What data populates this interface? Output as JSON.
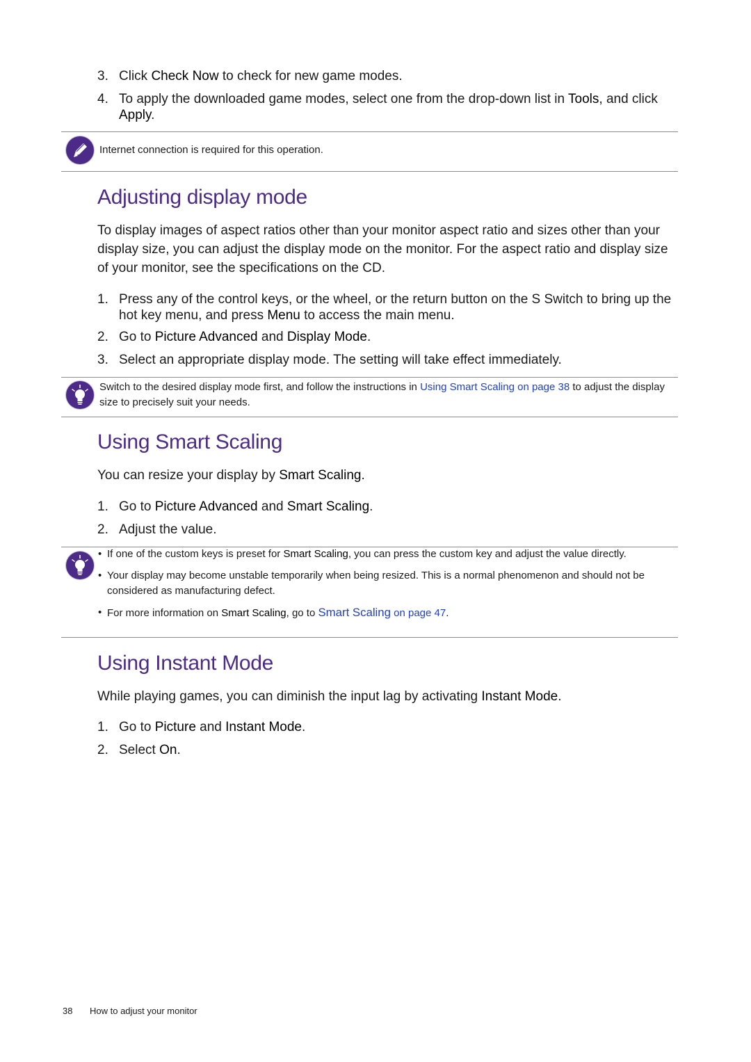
{
  "top_steps": [
    {
      "num": "3.",
      "parts": [
        {
          "t": "Click "
        },
        {
          "t": "Check Now",
          "b": true
        },
        {
          "t": " to check for new game modes."
        }
      ]
    },
    {
      "num": "4.",
      "parts": [
        {
          "t": "To apply the downloaded game modes, select one from the drop-down list in "
        },
        {
          "t": "Tools",
          "b": true
        },
        {
          "t": ", and click "
        },
        {
          "t": "Apply",
          "b": true
        },
        {
          "t": "."
        }
      ]
    }
  ],
  "note1": {
    "icon": "pencil-icon",
    "text": "Internet connection is required for this operation."
  },
  "section1": {
    "title": "Adjusting display mode",
    "intro": "To display images of aspect ratios other than your monitor aspect ratio and sizes other than your display size, you can adjust the display mode on the monitor. For the aspect ratio and display size of your monitor, see the specifications on the CD.",
    "steps": [
      {
        "num": "1.",
        "parts": [
          {
            "t": "Press any of the control keys, or the wheel, or the return button on the S Switch to bring up the hot key menu, and press "
          },
          {
            "t": "Menu",
            "b": true
          },
          {
            "t": " to access the main menu."
          }
        ]
      },
      {
        "num": "2.",
        "parts": [
          {
            "t": "Go to "
          },
          {
            "t": "Picture Advanced",
            "b": true
          },
          {
            "t": " and "
          },
          {
            "t": "Display Mode",
            "b": true
          },
          {
            "t": "."
          }
        ]
      },
      {
        "num": "3.",
        "parts": [
          {
            "t": "Select an appropriate display mode. The setting will take effect immediately."
          }
        ]
      }
    ],
    "tip": {
      "icon": "lightbulb-icon",
      "text_before": "Switch to the desired display mode first, and follow the instructions in ",
      "link": "Using Smart Scaling on page 38",
      "text_after": " to adjust the display size to precisely suit your needs."
    }
  },
  "section2": {
    "title": "Using Smart Scaling",
    "intro_parts": [
      {
        "t": "You can resize your display by "
      },
      {
        "t": "Smart Scaling",
        "b": true
      },
      {
        "t": "."
      }
    ],
    "steps": [
      {
        "num": "1.",
        "parts": [
          {
            "t": "Go to "
          },
          {
            "t": "Picture Advanced",
            "b": true
          },
          {
            "t": " and "
          },
          {
            "t": "Smart Scaling",
            "b": true
          },
          {
            "t": "."
          }
        ]
      },
      {
        "num": "2.",
        "parts": [
          {
            "t": "Adjust the value."
          }
        ]
      }
    ],
    "tip": {
      "icon": "lightbulb-icon",
      "bullets": [
        [
          {
            "t": "If one of the custom keys is preset for "
          },
          {
            "t": "Smart Scaling",
            "b": true
          },
          {
            "t": ", you can press the custom key and adjust the value directly."
          }
        ],
        [
          {
            "t": "Your display may become unstable temporarily when being resized. This is a normal phenomenon and should not be considered as manufacturing defect."
          }
        ],
        [
          {
            "t": "For more information on "
          },
          {
            "t": "Smart Scaling",
            "b": true
          },
          {
            "t": ", go to "
          },
          {
            "t": "Smart Scaling",
            "link": true,
            "big": true
          },
          {
            "t": " on page 47",
            "link": true
          },
          {
            "t": "."
          }
        ]
      ]
    }
  },
  "section3": {
    "title": "Using Instant Mode",
    "intro_parts": [
      {
        "t": "While playing games, you can diminish the input lag by activating "
      },
      {
        "t": "Instant Mode",
        "b": true
      },
      {
        "t": "."
      }
    ],
    "steps": [
      {
        "num": "1.",
        "parts": [
          {
            "t": "Go to "
          },
          {
            "t": "Picture",
            "b": true
          },
          {
            "t": " and "
          },
          {
            "t": "Instant Mode",
            "b": true
          },
          {
            "t": "."
          }
        ]
      },
      {
        "num": "2.",
        "parts": [
          {
            "t": "Select "
          },
          {
            "t": "On",
            "b": true
          },
          {
            "t": "."
          }
        ]
      }
    ]
  },
  "footer": {
    "page_number": "38",
    "chapter": "How to adjust your monitor"
  },
  "colors": {
    "heading": "#4b2a88",
    "link": "#1f3fd1",
    "icon_bg": "#4b2a88"
  }
}
